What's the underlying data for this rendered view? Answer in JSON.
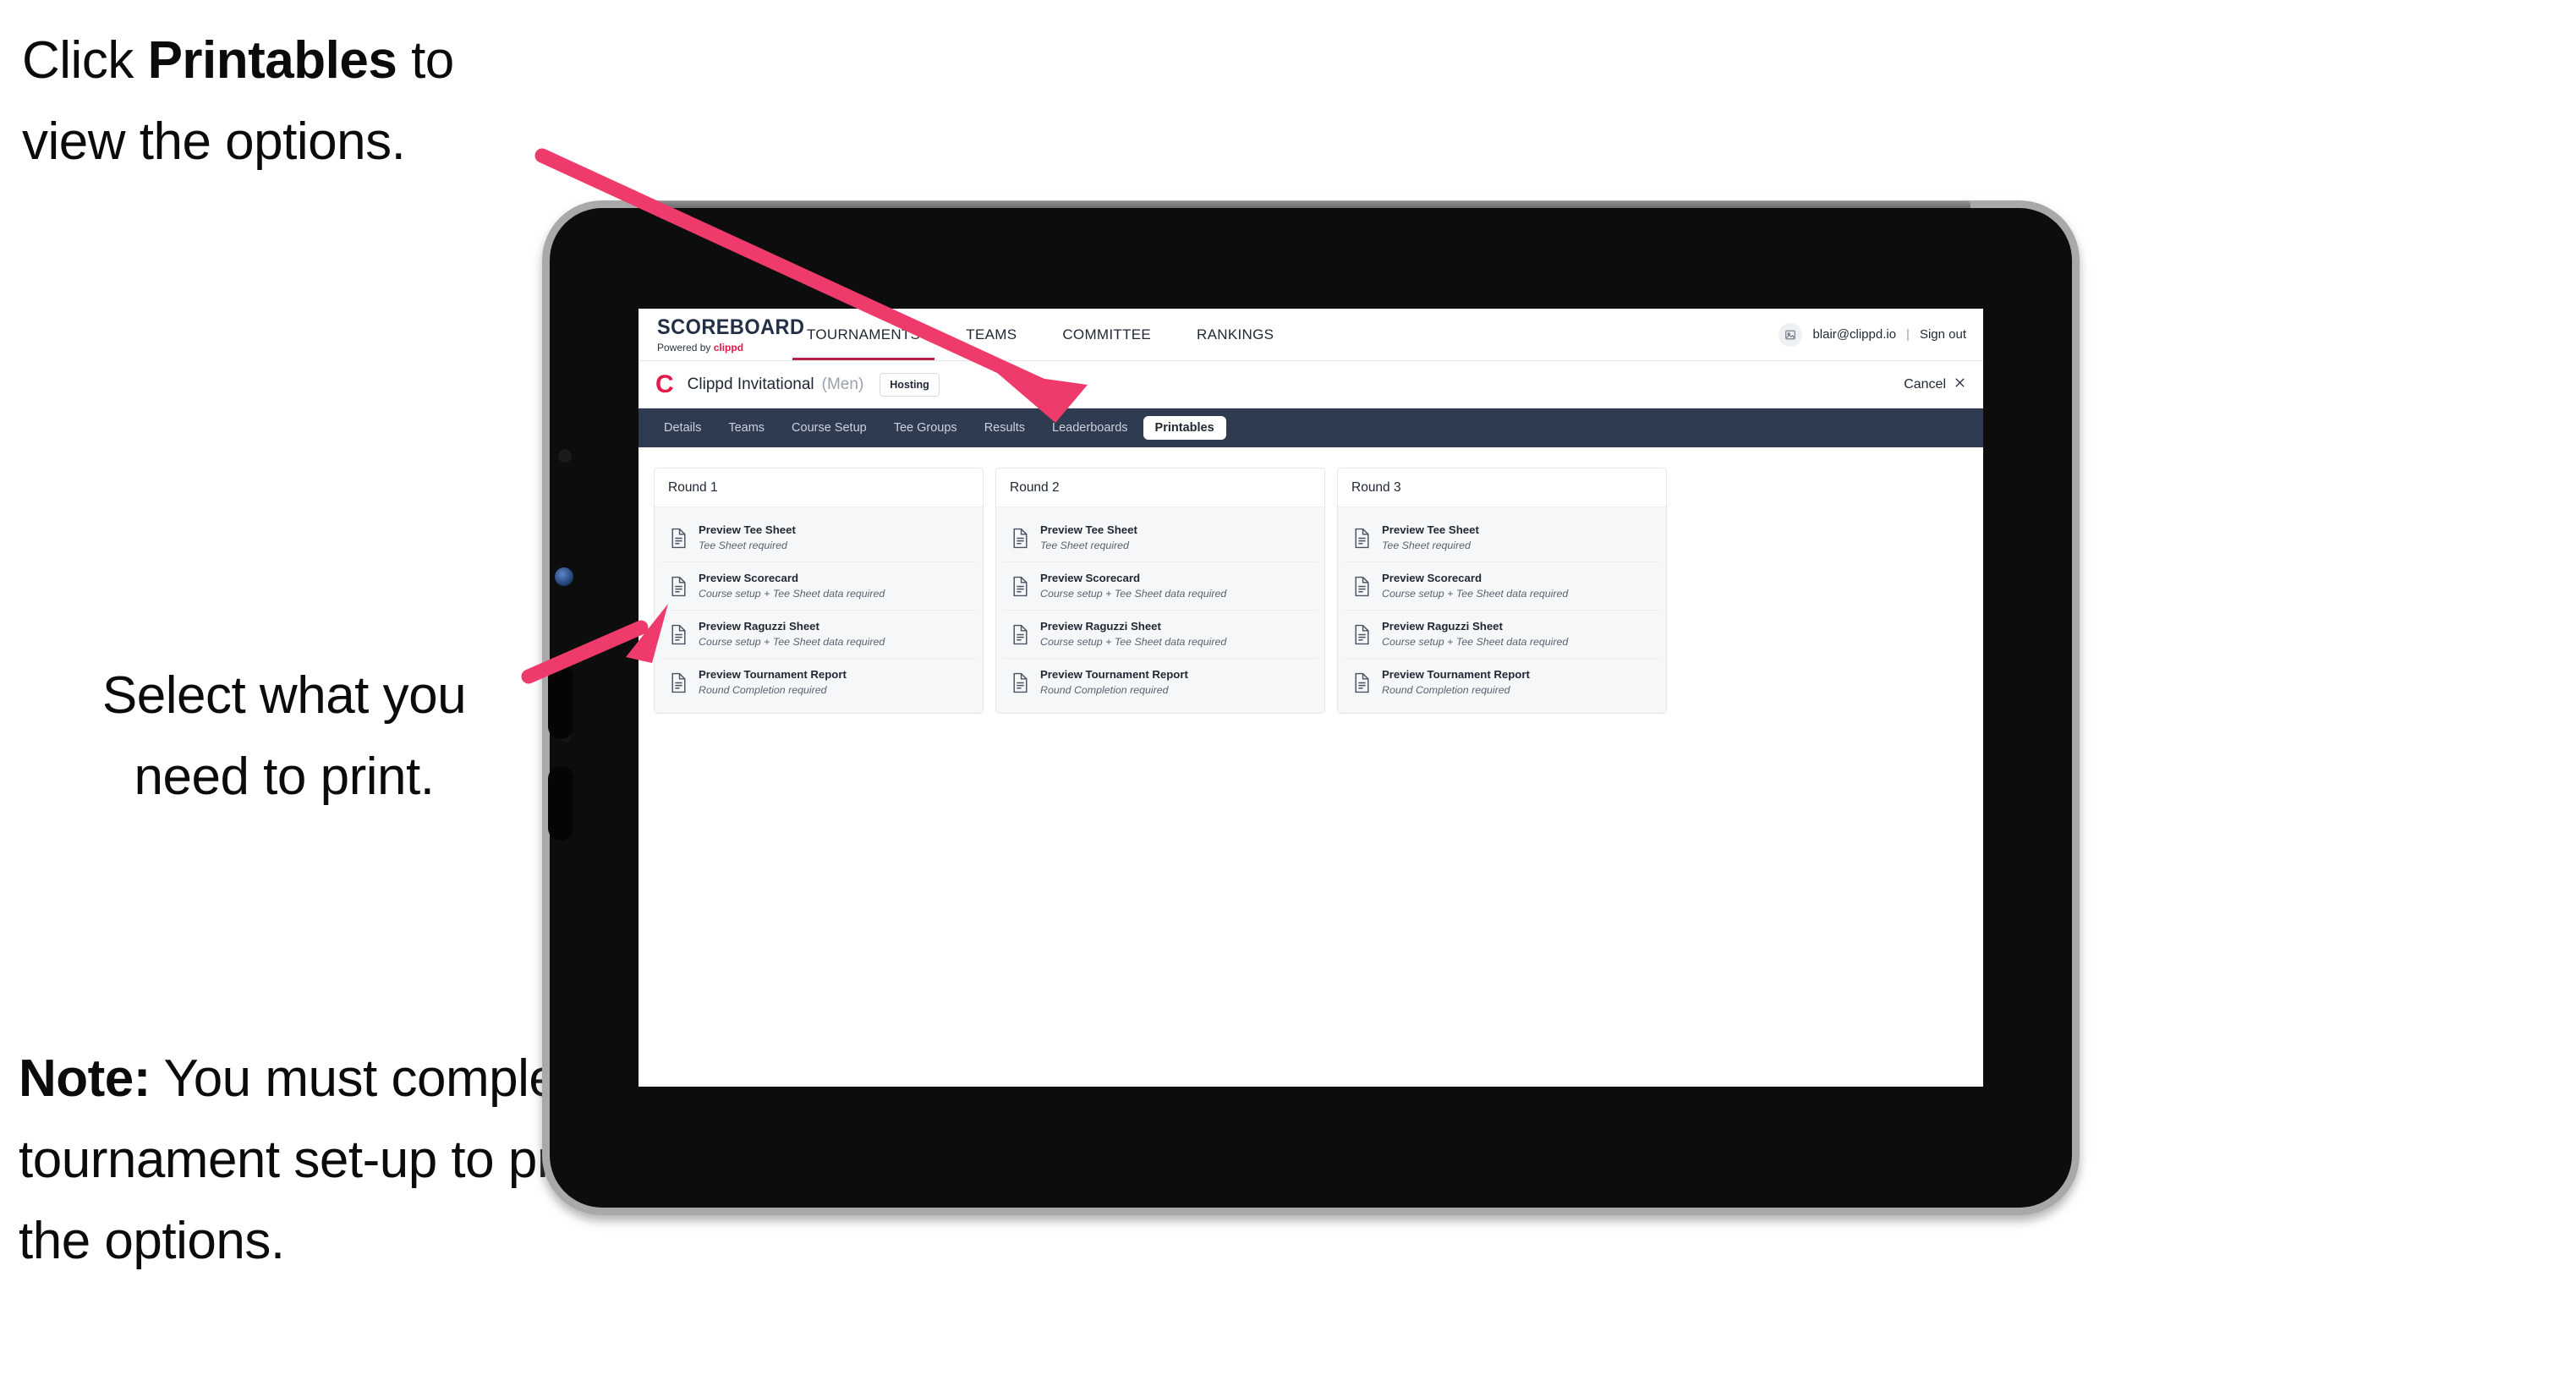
{
  "annotations": {
    "top": {
      "pre": "Click ",
      "bold": "Printables",
      "post": " to view the options."
    },
    "middle": {
      "line1": "Select what you",
      "line2": "need to print."
    },
    "note": {
      "bold": "Note:",
      "text": " You must complete the tournament set-up to print all the options."
    }
  },
  "colors": {
    "arrow_pink": "#ee3b6b",
    "tab_bar_navy": "#2e3b50",
    "brand_red": "#e8174a",
    "accent_underline": "#b8234b"
  },
  "app": {
    "brand": {
      "wordmark": "SCOREBOARD",
      "powered_prefix": "Powered by ",
      "powered_brand": "clippd"
    },
    "topnav": [
      {
        "label": "TOURNAMENTS",
        "active": true
      },
      {
        "label": "TEAMS",
        "active": false
      },
      {
        "label": "COMMITTEE",
        "active": false
      },
      {
        "label": "RANKINGS",
        "active": false
      }
    ],
    "account": {
      "email": "blair@clippd.io",
      "separator": "|",
      "signout": "Sign out",
      "avatar_icon": "user-avatar-icon"
    },
    "tournament": {
      "logo_letter": "C",
      "name": "Clippd Invitational",
      "gender": "(Men)",
      "status_badge": "Hosting",
      "cancel_label": "Cancel",
      "cancel_icon": "close-icon"
    },
    "section_tabs": [
      {
        "label": "Details",
        "active": false
      },
      {
        "label": "Teams",
        "active": false
      },
      {
        "label": "Course Setup",
        "active": false
      },
      {
        "label": "Tee Groups",
        "active": false
      },
      {
        "label": "Results",
        "active": false
      },
      {
        "label": "Leaderboards",
        "active": false
      },
      {
        "label": "Printables",
        "active": true
      }
    ],
    "rounds": [
      {
        "title": "Round 1",
        "items": [
          {
            "icon": "document-icon",
            "title": "Preview Tee Sheet",
            "subtitle": "Tee Sheet required"
          },
          {
            "icon": "document-icon",
            "title": "Preview Scorecard",
            "subtitle": "Course setup + Tee Sheet data required"
          },
          {
            "icon": "document-icon",
            "title": "Preview Raguzzi Sheet",
            "subtitle": "Course setup + Tee Sheet data required"
          },
          {
            "icon": "document-icon",
            "title": "Preview Tournament Report",
            "subtitle": "Round Completion required"
          }
        ]
      },
      {
        "title": "Round 2",
        "items": [
          {
            "icon": "document-icon",
            "title": "Preview Tee Sheet",
            "subtitle": "Tee Sheet required"
          },
          {
            "icon": "document-icon",
            "title": "Preview Scorecard",
            "subtitle": "Course setup + Tee Sheet data required"
          },
          {
            "icon": "document-icon",
            "title": "Preview Raguzzi Sheet",
            "subtitle": "Course setup + Tee Sheet data required"
          },
          {
            "icon": "document-icon",
            "title": "Preview Tournament Report",
            "subtitle": "Round Completion required"
          }
        ]
      },
      {
        "title": "Round 3",
        "items": [
          {
            "icon": "document-icon",
            "title": "Preview Tee Sheet",
            "subtitle": "Tee Sheet required"
          },
          {
            "icon": "document-icon",
            "title": "Preview Scorecard",
            "subtitle": "Course setup + Tee Sheet data required"
          },
          {
            "icon": "document-icon",
            "title": "Preview Raguzzi Sheet",
            "subtitle": "Course setup + Tee Sheet data required"
          },
          {
            "icon": "document-icon",
            "title": "Preview Tournament Report",
            "subtitle": "Round Completion required"
          }
        ]
      }
    ]
  }
}
